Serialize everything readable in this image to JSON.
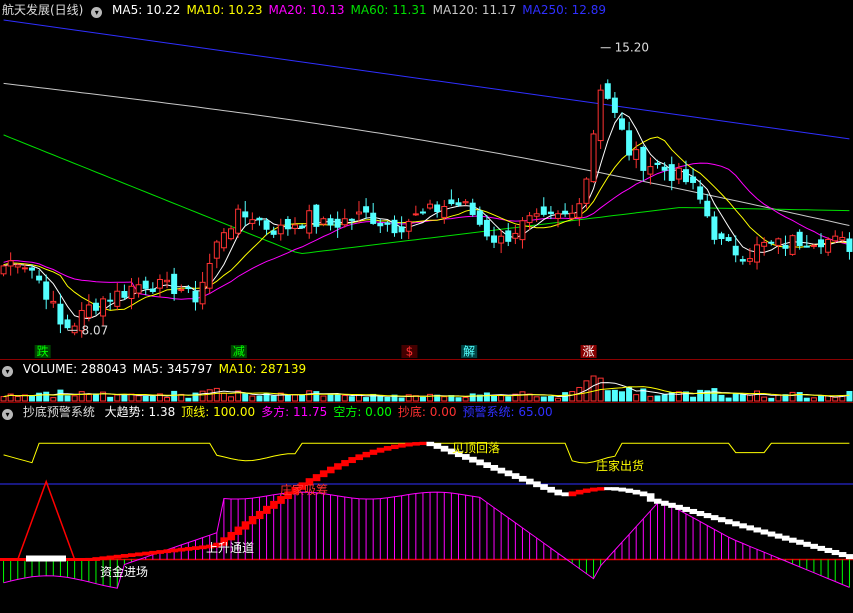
{
  "colors": {
    "up": "#ff3232",
    "down": "#54ffff",
    "ma5": "#ffffff",
    "ma10": "#ffff00",
    "ma20": "#ff00ff",
    "ma60": "#00e000",
    "ma120": "#c8c8c8",
    "ma250": "#2f2fff",
    "axis": "#b00000"
  },
  "main_panel": {
    "title": "航天发展(日线)",
    "icon": "chevron-down-icon",
    "ma": [
      {
        "label": "MA5:",
        "value": "10.22",
        "color": "#ffffff"
      },
      {
        "label": "MA10:",
        "value": "10.23",
        "color": "#ffff00"
      },
      {
        "label": "MA20:",
        "value": "10.13",
        "color": "#ff00ff"
      },
      {
        "label": "MA60:",
        "value": "11.31",
        "color": "#00e000"
      },
      {
        "label": "MA120:",
        "value": "11.17",
        "color": "#c8c8c8"
      },
      {
        "label": "MA250:",
        "value": "12.89",
        "color": "#2f2fff"
      }
    ],
    "high_label": "15.20",
    "low_label": "8.07",
    "events": [
      {
        "label": "跌",
        "color": "#00ff00",
        "bg": "#004400",
        "x": 0.05
      },
      {
        "label": "减",
        "color": "#00ff00",
        "bg": "#004400",
        "x": 0.28
      },
      {
        "label": "$",
        "color": "#ff3232",
        "bg": "#440000",
        "x": 0.48
      },
      {
        "label": "解",
        "color": "#54ffff",
        "bg": "#004444",
        "x": 0.55
      },
      {
        "label": "涨",
        "color": "#ffffff",
        "bg": "#880000",
        "x": 0.69
      }
    ]
  },
  "volume_panel": {
    "items": [
      {
        "label": "VOLUME:",
        "value": "288043",
        "color": "#ffffff"
      },
      {
        "label": "MA5:",
        "value": "345797",
        "color": "#ffffff"
      },
      {
        "label": "MA10:",
        "value": "287139",
        "color": "#ffff00"
      }
    ]
  },
  "indicator_panel": {
    "title": "抄底预警系统",
    "items": [
      {
        "label": "大趋势:",
        "value": "1.38",
        "color": "#ffffff"
      },
      {
        "label": "顶线:",
        "value": "100.00",
        "color": "#ffff00"
      },
      {
        "label": "多方:",
        "value": "11.75",
        "color": "#ff00ff"
      },
      {
        "label": "空方:",
        "value": "0.00",
        "color": "#00ff00"
      },
      {
        "label": "抄底:",
        "value": "0.00",
        "color": "#ff3232"
      },
      {
        "label": "预警系统:",
        "value": "65.00",
        "color": "#2f2fff"
      }
    ],
    "annotations": [
      {
        "text": "资金进场",
        "color": "#ffffff"
      },
      {
        "text": "上升通道",
        "color": "#ffffff"
      },
      {
        "text": "庄家吸筹",
        "color": "#ff3232"
      },
      {
        "text": "见顶回落",
        "color": "#ffff00"
      },
      {
        "text": "庄家出货",
        "color": "#ffff00"
      }
    ]
  },
  "chart_data": {
    "type": "candlestick",
    "y_range": [
      7.7,
      15.9
    ],
    "price_path": [
      9.7,
      9.9,
      9.6,
      9.0,
      8.1,
      8.3,
      8.7,
      8.9,
      9.0,
      9.2,
      9.3,
      9.1,
      9.2,
      8.8,
      9.6,
      10.6,
      10.9,
      11.0,
      10.7,
      10.6,
      10.8,
      10.9,
      10.7,
      10.8,
      10.9,
      11.0,
      10.8,
      10.7,
      10.9,
      11.0,
      11.2,
      11.3,
      11.1,
      10.6,
      10.3,
      10.6,
      10.8,
      10.8,
      10.9,
      11.0,
      12.0,
      14.4,
      13.4,
      12.5,
      12.3,
      12.2,
      12.0,
      11.8,
      11.2,
      10.3,
      10.1,
      10.0,
      10.2,
      10.2,
      10.3,
      10.4,
      10.4,
      10.3,
      10.22
    ],
    "n_candles": 120
  }
}
